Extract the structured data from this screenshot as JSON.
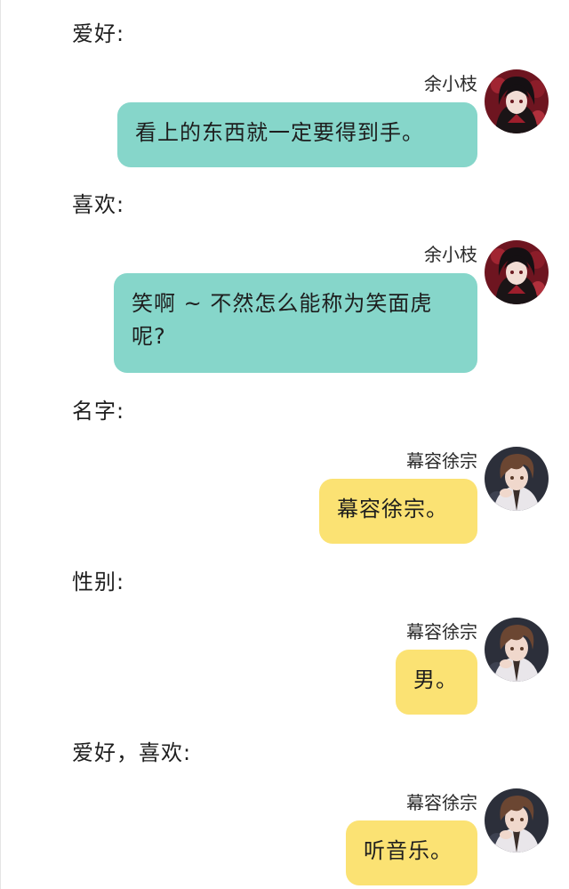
{
  "conversation": [
    {
      "type": "label",
      "text": "爱好:"
    },
    {
      "type": "message",
      "sender": "余小枝",
      "text": "看上的东西就一定要得到手。",
      "bubble_color": "#86d6ca",
      "avatar": "girl-avatar-icon"
    },
    {
      "type": "label",
      "text": "喜欢:"
    },
    {
      "type": "message",
      "sender": "余小枝",
      "text": "笑啊 ~ 不然怎么能称为笑面虎呢?",
      "bubble_color": "#86d6ca",
      "avatar": "girl-avatar-icon"
    },
    {
      "type": "label",
      "text": "名字:"
    },
    {
      "type": "message",
      "sender": "幕容徐宗",
      "text": "幕容徐宗。",
      "bubble_color": "#fbe273",
      "avatar": "boy-avatar-icon"
    },
    {
      "type": "label",
      "text": "性别:"
    },
    {
      "type": "message",
      "sender": "幕容徐宗",
      "text": "男。",
      "bubble_color": "#fbe273",
      "avatar": "boy-avatar-icon"
    },
    {
      "type": "label",
      "text": "爱好，喜欢:"
    },
    {
      "type": "message",
      "sender": "幕容徐宗",
      "text": "听音乐。",
      "bubble_color": "#fbe273",
      "avatar": "boy-avatar-icon"
    }
  ]
}
